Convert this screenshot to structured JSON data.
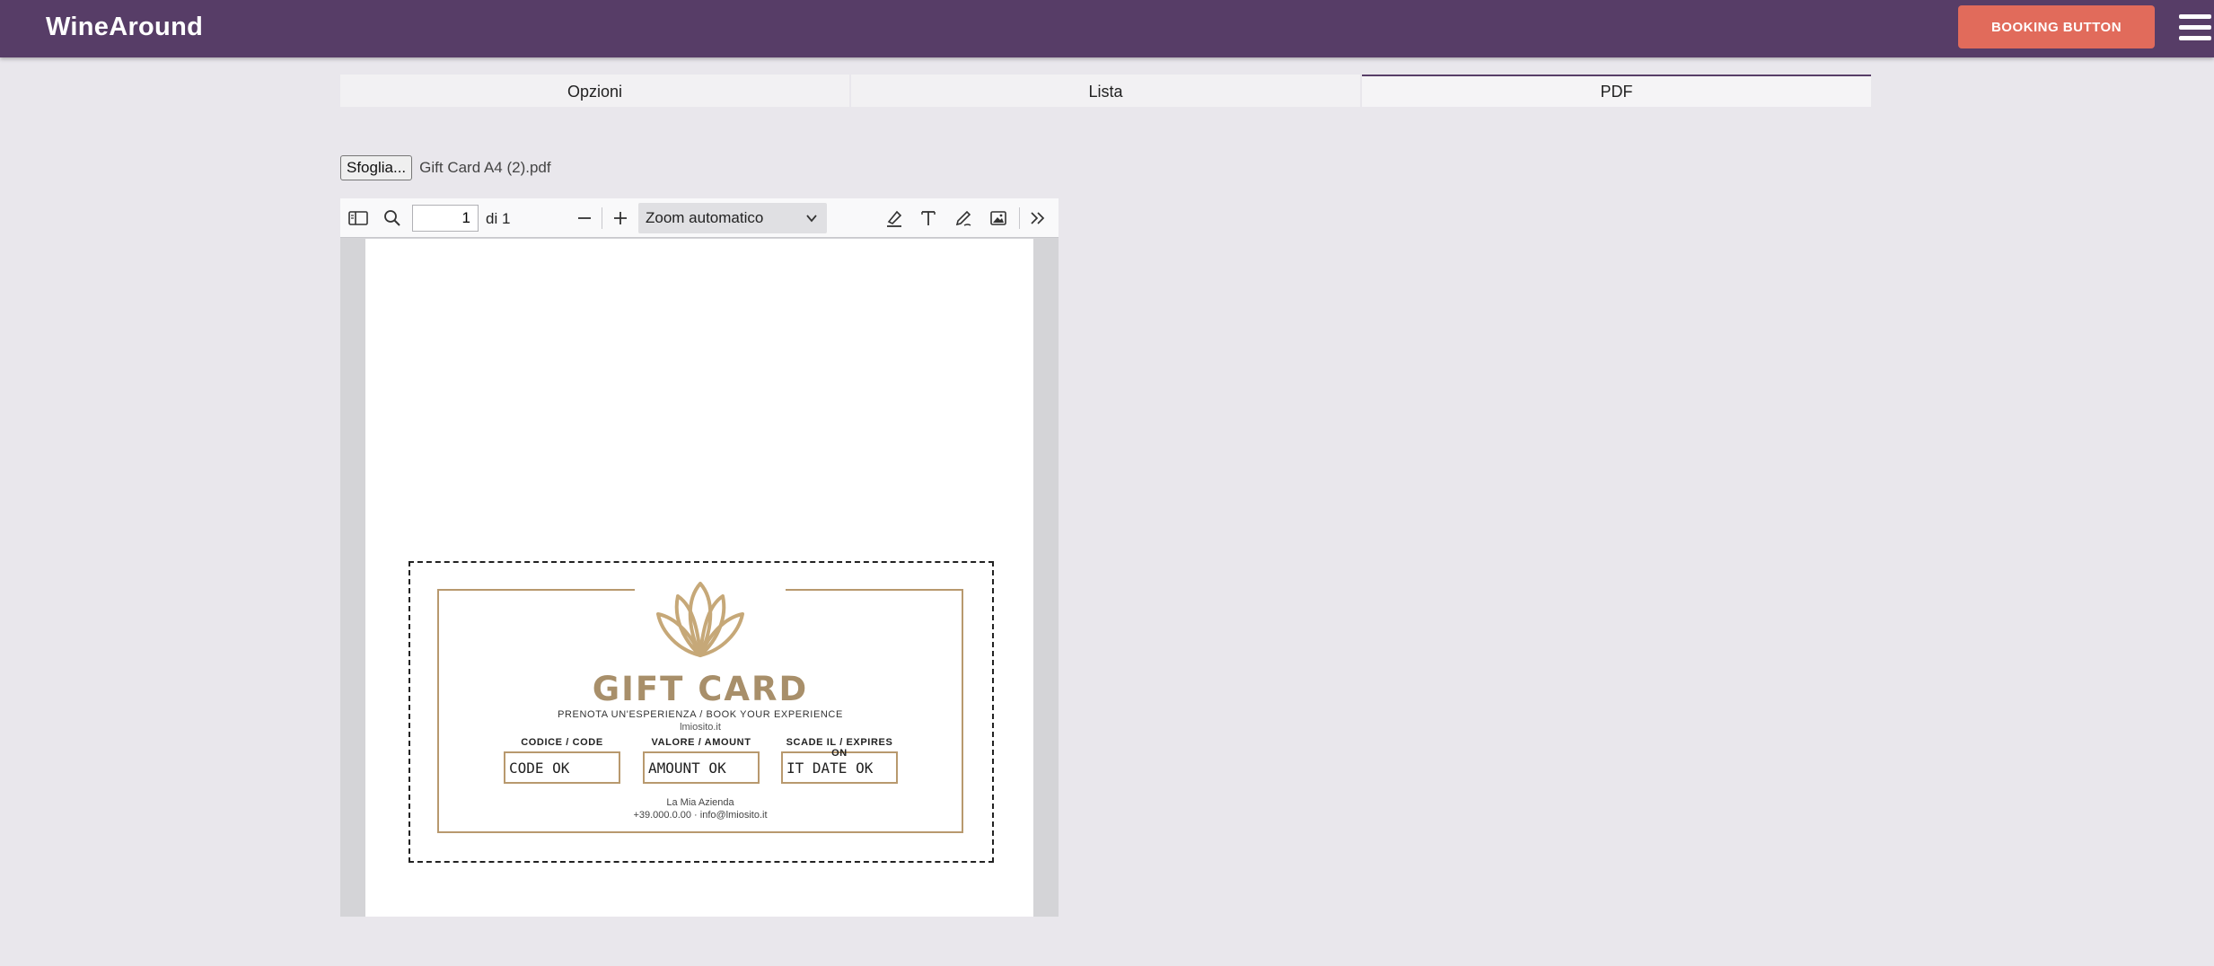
{
  "header": {
    "logo": "WineAround",
    "booking_button": "BOOKING BUTTON"
  },
  "tabs": [
    {
      "label": "Opzioni",
      "active": false
    },
    {
      "label": "Lista",
      "active": false
    },
    {
      "label": "PDF",
      "active": true
    }
  ],
  "file_input": {
    "button_label": "Sfoglia...",
    "file_name": "Gift Card A4 (2).pdf"
  },
  "pdf_viewer": {
    "page_value": "1",
    "page_count": "di 1",
    "zoom": "Zoom automatico",
    "icons": [
      "sidebar-toggle-icon",
      "search-icon",
      "zoom-out-icon",
      "zoom-in-icon",
      "highlight-icon",
      "text-icon",
      "draw-icon",
      "image-icon",
      "more-tools-icon"
    ]
  },
  "gift_card": {
    "title": "GIFT CARD",
    "subtitle": "PRENOTA UN'ESPERIENZA  /  BOOK YOUR EXPERIENCE",
    "website": "lmiosito.it",
    "fields": [
      {
        "label": "CODICE / CODE",
        "value": "CODE OK"
      },
      {
        "label": "VALORE / AMOUNT",
        "value": "AMOUNT OK"
      },
      {
        "label": "SCADE IL / EXPIRES ON",
        "value": "IT DATE OK"
      }
    ],
    "company": "La Mia Azienda",
    "contact": "+39.000.0.00 · info@lmiosito.it"
  },
  "colors": {
    "header_bg": "#573d67",
    "booking_button_bg": "#e16b5b",
    "gift_card_gold": "#b8996e"
  }
}
